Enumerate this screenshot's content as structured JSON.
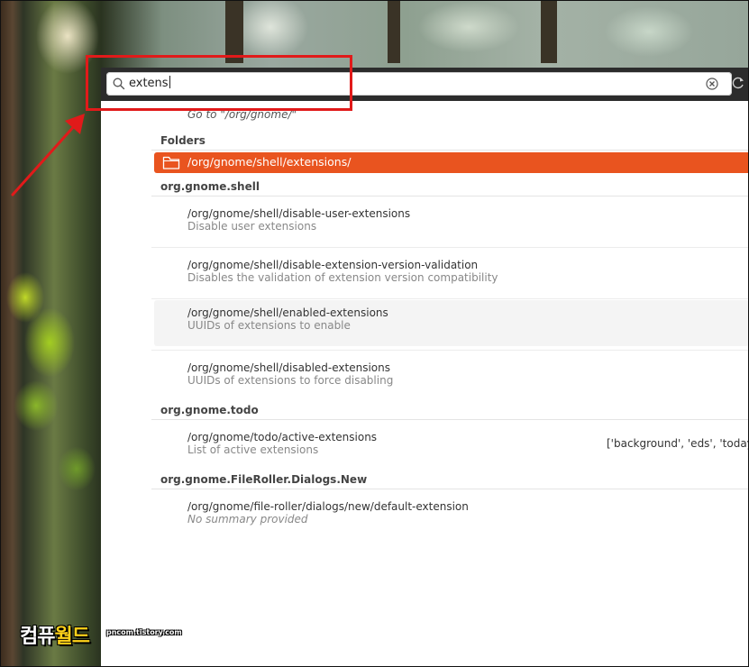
{
  "search": {
    "value": "extens"
  },
  "goto": {
    "label": "Go to \"/org/gnome/\""
  },
  "sections": {
    "folders": "Folders",
    "shell": "org.gnome.shell",
    "todo": "org.gnome.todo",
    "fileroller": "org.gnome.FileRoller.Dialogs.New"
  },
  "folder_result": {
    "path": "/org/gnome/shell/extensions/"
  },
  "keys": [
    {
      "path": "/org/gnome/shell/disable-user-extensions",
      "summary": "Disable user extensions",
      "value": ""
    },
    {
      "path": "/org/gnome/shell/disable-extension-version-validation",
      "summary": "Disables the validation of extension version compatibility",
      "value": ""
    },
    {
      "path": "/org/gnome/shell/enabled-extensions",
      "summary": "UUIDs of extensions to enable",
      "value": ""
    },
    {
      "path": "/org/gnome/shell/disabled-extensions",
      "summary": "UUIDs of extensions to force disabling",
      "value": ""
    },
    {
      "path": "/org/gnome/todo/active-extensions",
      "summary": "List of active extensions",
      "value": "['background', 'eds', 'today-p"
    },
    {
      "path": "/org/gnome/file-roller/dialogs/new/default-extension",
      "summary": "No summary provided",
      "value": ""
    }
  ],
  "watermark": {
    "main_a": "컴퓨",
    "main_b": "월드",
    "site": "pncom.tistory.com"
  },
  "colors": {
    "accent": "#e9541f",
    "annotation": "#e11a1a",
    "headerbar": "#2c2c2c"
  },
  "icons": {
    "search": "search-icon",
    "clear": "clear-icon",
    "refresh": "refresh-icon",
    "folder": "folder-icon",
    "goto": "go-up-icon"
  }
}
